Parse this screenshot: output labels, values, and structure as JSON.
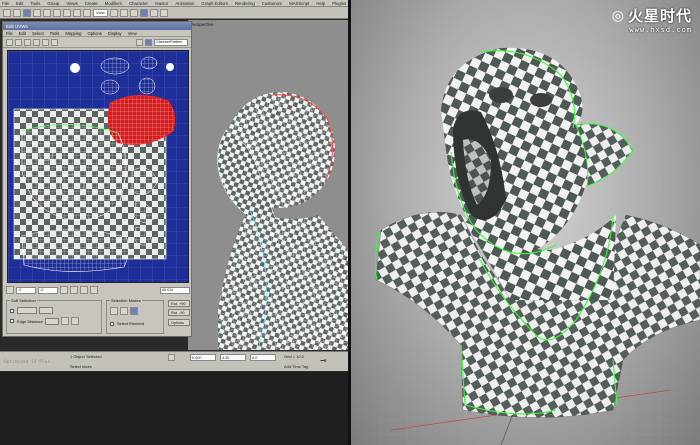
{
  "left_app": {
    "menu": [
      "File",
      "Edit",
      "Tools",
      "Group",
      "Views",
      "Create",
      "Modifiers",
      "Character",
      "reactor",
      "Animation",
      "Graph Editors",
      "Rendering",
      "Customize",
      "MAXScript",
      "Help",
      "Plugins"
    ],
    "toolbar": {
      "view_dropdown": "View"
    },
    "viewport": {
      "label": "Perspective"
    },
    "uvw_dialog": {
      "title": "Edit UVWs",
      "menu": [
        "File",
        "Edit",
        "Select",
        "Tools",
        "Mapping",
        "Options",
        "Display",
        "View"
      ],
      "map_dropdown": "CheckerPattern",
      "coord_u": "-0",
      "coord_v": "-0",
      "all_ids": "All IDs",
      "selection_title": "Soft Selection",
      "edge_distance": "Edge Distance",
      "options_label": "Options",
      "sub_object_title": "Selection Modes",
      "select_element": "Select Element",
      "edit_label": "Edit Line",
      "rot90": "Rot. +90",
      "rot_minus90": "Rot. -90"
    },
    "status": {
      "objects_selected": "1 Object Selected",
      "select_faces": "Select faces",
      "x_value": "0.000",
      "y_value": "4.32",
      "z_value": "0.0",
      "grid": "Grid = 10.0",
      "add_time_tag": "Add Time Tag",
      "watermark": "Optimized 14 Plus"
    }
  },
  "right_render": {
    "logo_text": "火星时代",
    "logo_url": "www.hxsd.com"
  },
  "colors": {
    "uv_bg": "#1f2f9a",
    "seam_green": "#33ff33",
    "seam_red": "#ff3333",
    "checker_light": "#f0f0f0",
    "checker_dark": "#5a6460"
  }
}
